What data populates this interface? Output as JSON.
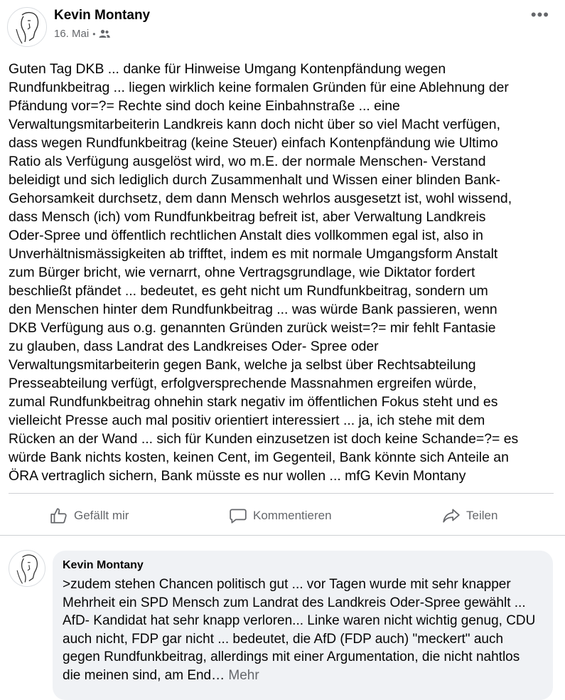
{
  "post": {
    "author": "Kevin Montany",
    "date": "16. Mai",
    "audience_icon": "friends-icon",
    "body": "Guten Tag DKB ... danke für Hinweise Umgang Kontenpfändung wegen\nRundfunkbeitrag ... liegen wirklich keine formalen Gründen für eine Ablehnung der\nPfändung vor=?= Rechte sind doch keine Einbahnstraße ... eine\nVerwaltungsmitarbeiterin Landkreis kann doch nicht über so viel Macht verfügen,\ndass wegen Rundfunkbeitrag (keine Steuer) einfach Kontenpfändung wie Ultimo\nRatio als Verfügung ausgelöst wird, wo m.E. der normale Menschen- Verstand\nbeleidigt und sich lediglich durch Zusammenhalt und Wissen  einer blinden Bank-\nGehorsamkeit durchsetz, dem dann Mensch wehrlos ausgesetzt ist, wohl wissend,\ndass Mensch (ich) vom Rundfunkbeitrag befreit ist, aber Verwaltung Landkreis\nOder-Spree und öffentlich rechtlichen Anstalt dies vollkommen egal ist, also in\nUnverhältnismässigkeiten ab trifftet, indem es mit normale Umgangsform Anstalt\nzum Bürger bricht, wie vernarrt, ohne Vertragsgrundlage, wie Diktator fordert\nbeschließt pfändet ... bedeutet, es geht nicht um Rundfunkbeitrag, sondern um\nden Menschen hinter dem Rundfunkbeitrag ... was würde Bank passieren, wenn\nDKB Verfügung aus o.g.  genannten Gründen zurück weist=?= mir fehlt Fantasie\nzu glauben, dass Landrat des Landkreises Oder- Spree oder\nVerwaltungsmitarbeiterin gegen Bank, welche ja selbst über Rechtsabteilung\nPresseabteilung verfügt, erfolgversprechende Massnahmen ergreifen würde,\nzumal Rundfunkbeitrag ohnehin stark negativ im öffentlichen Fokus steht und es\nvielleicht Presse auch mal positiv orientiert interessiert ... ja, ich stehe mit dem\nRücken an der Wand ... sich für Kunden einzusetzen ist doch keine Schande=?= es\nwürde Bank nichts kosten, keinen Cent, im Gegenteil, Bank könnte sich Anteile an\nÖRA vertraglich sichern, Bank müsste es nur wollen ... mfG Kevin Montany"
  },
  "actions": {
    "like": "Gefällt mir",
    "comment": "Kommentieren",
    "share": "Teilen"
  },
  "comment": {
    "author": "Kevin Montany",
    "text": ">zudem stehen Chancen politisch gut ... vor Tagen wurde mit sehr knapper Mehrheit ein SPD Mensch zum Landrat des Landkreis Oder-Spree gewählt ... AfD- Kandidat  hat sehr knapp verloren... Linke waren nicht wichtig genug, CDU auch nicht, FDP gar nicht ... bedeutet, die AfD (FDP auch)  \"meckert\" auch gegen Rundfunkbeitrag, allerdings mit einer Argumentation, die nicht nahtlos die meinen sind, am End…",
    "more": "Mehr"
  },
  "colors": {
    "secondary_text": "#65676b",
    "bubble": "#f0f2f5",
    "divider": "#ced0d4"
  }
}
